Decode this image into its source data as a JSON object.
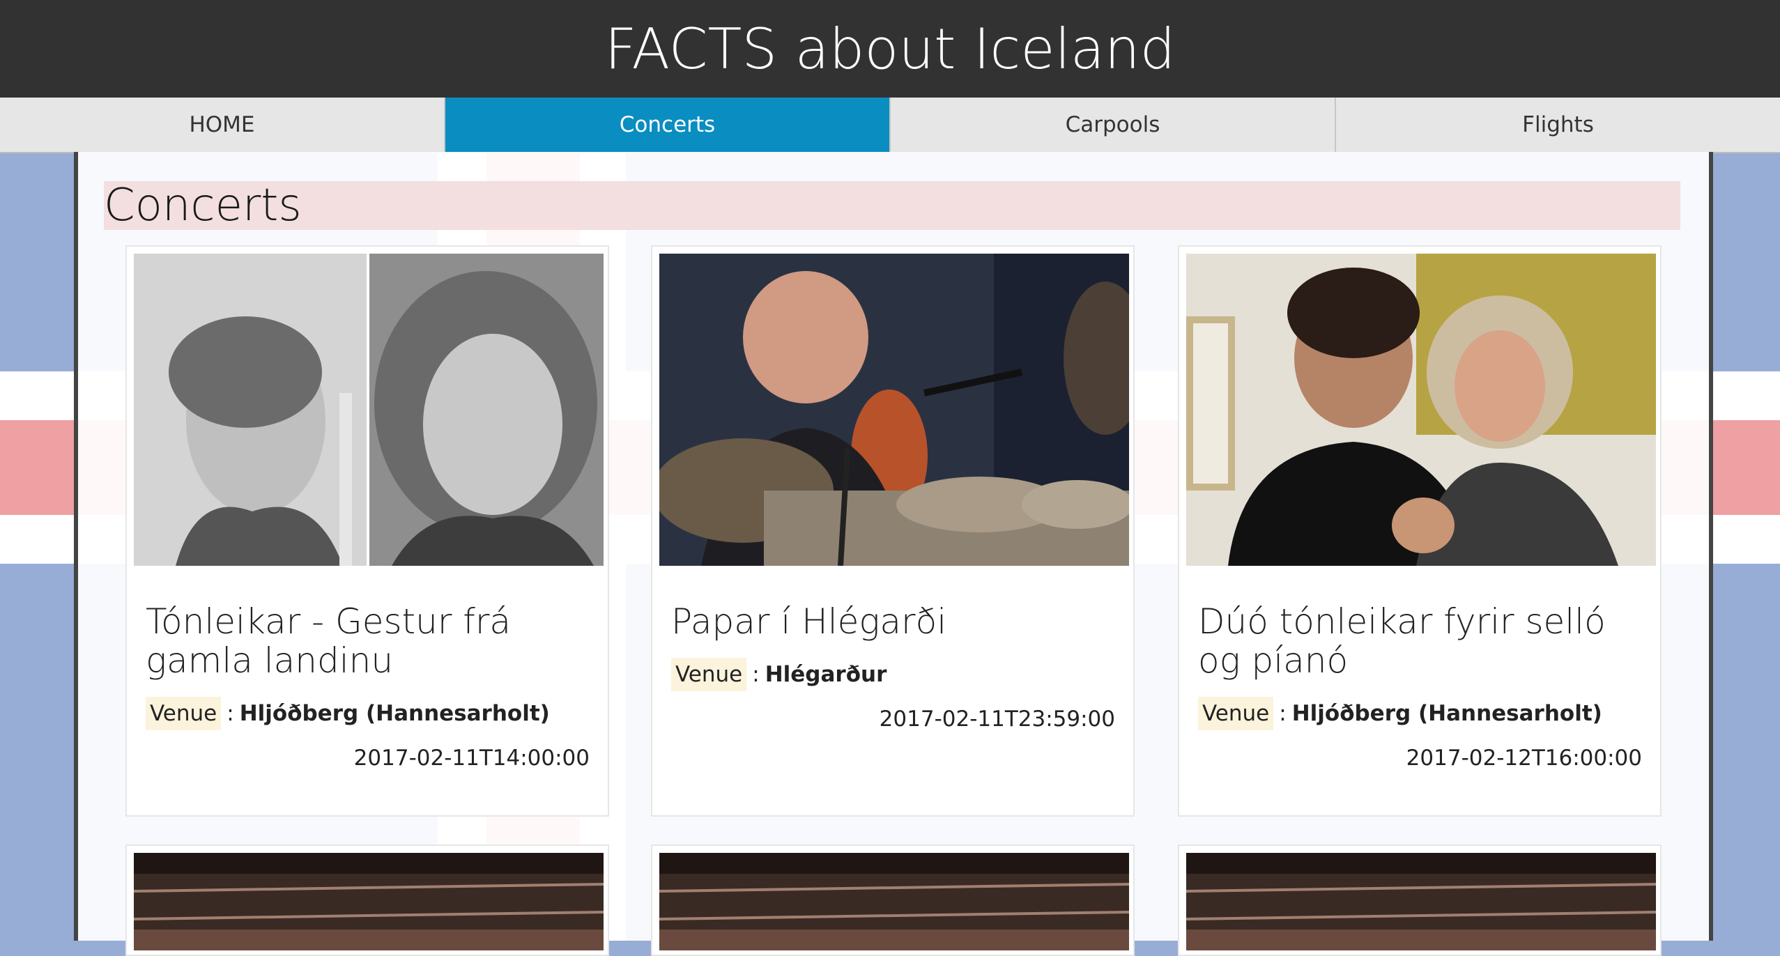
{
  "site": {
    "title": "FACTS about Iceland"
  },
  "nav": {
    "tabs": [
      {
        "label": "HOME"
      },
      {
        "label": "Concerts"
      },
      {
        "label": "Carpools"
      },
      {
        "label": "Flights"
      }
    ],
    "active_index": 1
  },
  "page": {
    "heading": "Concerts"
  },
  "concerts": [
    {
      "title": "Tónleikar - Gestur frá gamla landinu",
      "venue_label": "Venue",
      "venue_sep": ":",
      "venue": "Hljóðberg (Hannesarholt)",
      "date": "2017-02-11T14:00:00"
    },
    {
      "title": "Papar í Hlégarði",
      "venue_label": "Venue",
      "venue_sep": ":",
      "venue": "Hlégarður",
      "date": "2017-02-11T23:59:00"
    },
    {
      "title": "Dúó tónleikar fyrir selló og píanó",
      "venue_label": "Venue",
      "venue_sep": ":",
      "venue": "Hljóðberg (Hannesarholt)",
      "date": "2017-02-12T16:00:00"
    }
  ],
  "colors": {
    "header_bg": "#323232",
    "nav_active": "#0a8dc1",
    "flag_blue": "#97add6",
    "flag_red": "#eea0a2",
    "heading_bg": "#f3dfe0",
    "venue_label_bg": "#fbf3dc"
  }
}
